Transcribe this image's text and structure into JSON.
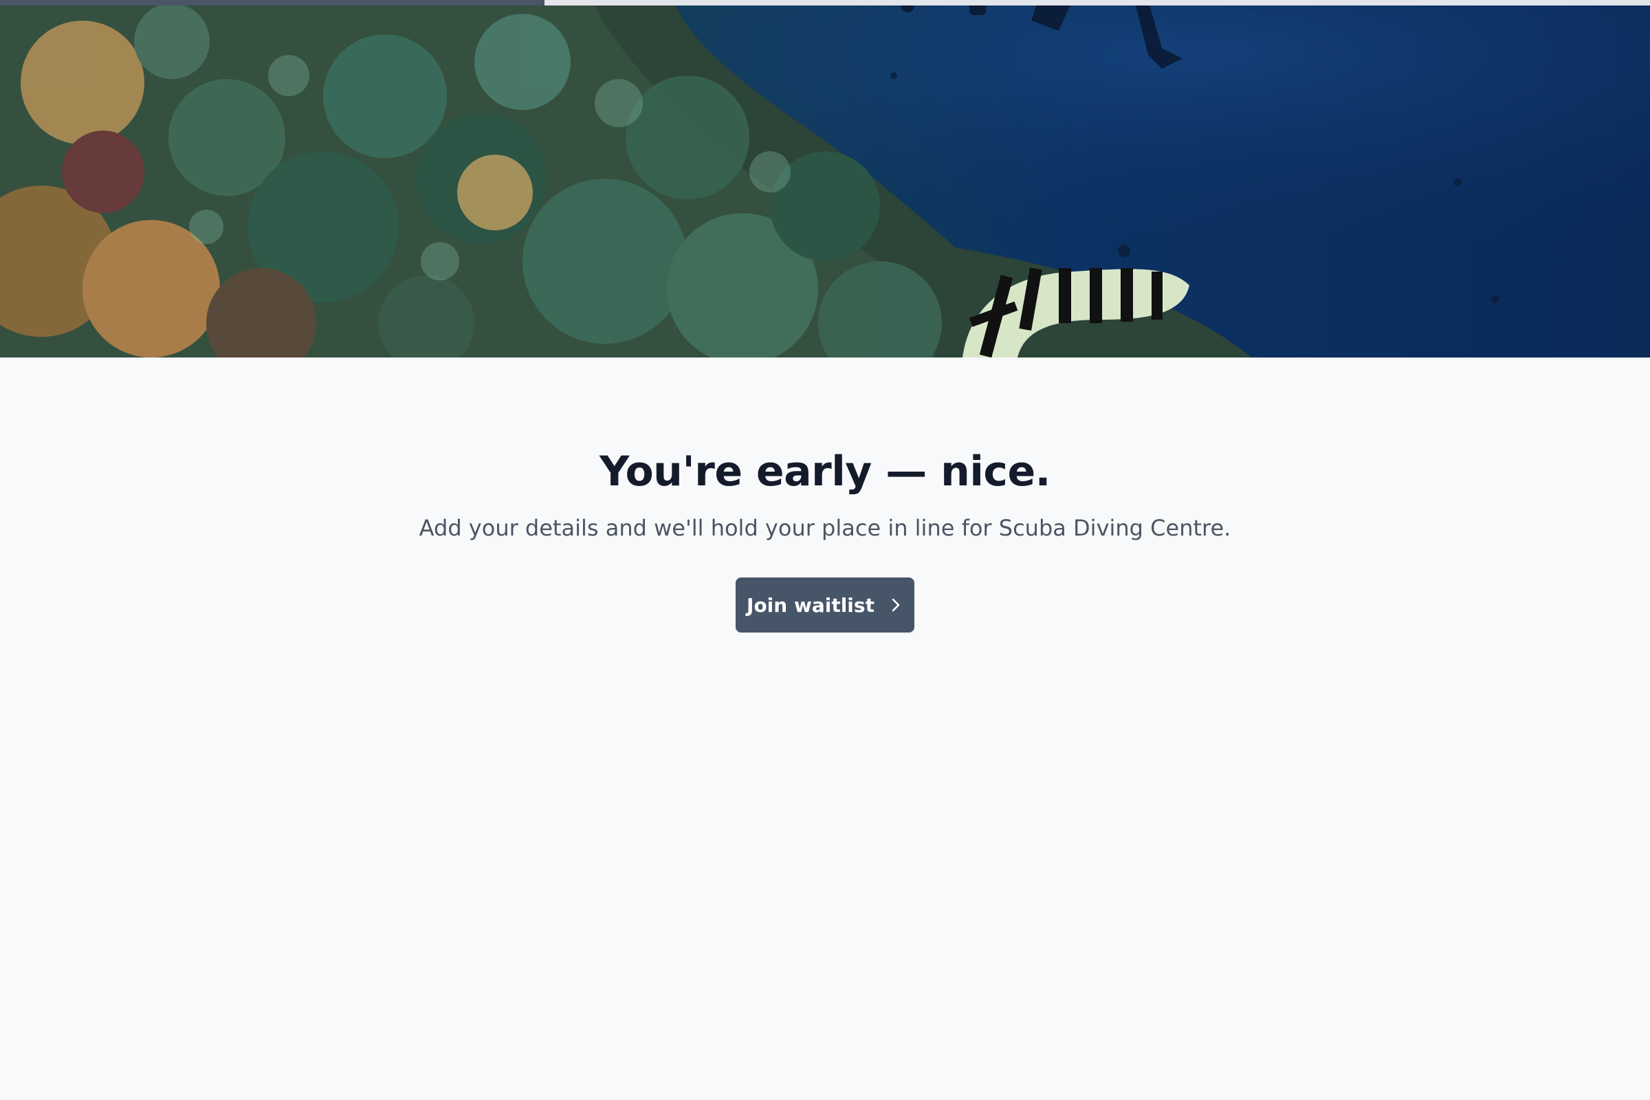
{
  "progress": {
    "value": 0.33
  },
  "hero": {
    "image_icon": "coral-reef-sea-snake-photo"
  },
  "main": {
    "headline": "You're early — nice.",
    "subtitle": "Add your details and we'll hold your place in line for Scuba Diving Centre.",
    "cta_label": "Join waitlist",
    "cta_icon": "chevron-right-icon"
  },
  "colors": {
    "background": "#f8f9fb",
    "headline": "#141b2b",
    "subtitle": "#4b5563",
    "button": "#475569",
    "progress_fill": "#4a5568",
    "progress_track": "#e2e5ea"
  }
}
